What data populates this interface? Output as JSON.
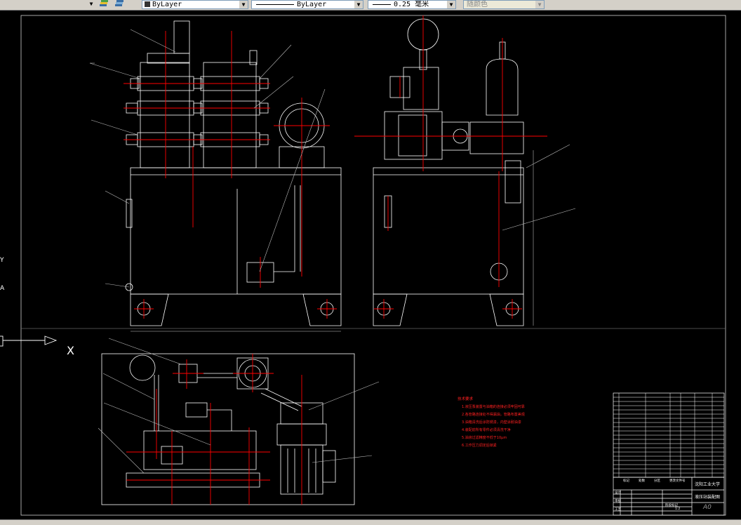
{
  "toolbar": {
    "layer_color_combo": "ByLayer",
    "linetype_combo": "ByLayer",
    "lineweight_combo": "0.25 毫米",
    "plotstyle_combo": "随颜色"
  },
  "drawing": {
    "ucs_axis_label": "X",
    "side_letters": [
      "Y",
      "A"
    ],
    "tech_notes": {
      "title": "技术要求",
      "items": [
        "1.液压泵装置与油箱的连接必须牢固可靠",
        "2.各管路连接处不得漏油，管路布置美观",
        "3.油箱清洗后涂防锈漆，内壁涂耐油漆",
        "4.装配前所有零件必须清洗干净",
        "5.油液过滤精度不低于10μm",
        "6.工作压力调定后锁紧"
      ]
    },
    "title_block": {
      "school": "沈阳工业大学",
      "drawing_name": "液压站装配图",
      "sheet_size": "A0",
      "labels": [
        "标记",
        "处数",
        "分区",
        "更改文件号",
        "签名",
        "年月日",
        "设计",
        "审核",
        "工艺",
        "批准",
        "阶段标记",
        "重量",
        "比例",
        "共张第张"
      ],
      "scale": "1:2"
    }
  },
  "colors": {
    "background": "#000000",
    "geometry": "#ffffff",
    "centerline": "#ff0000",
    "toolbar": "#d4d0c8"
  }
}
